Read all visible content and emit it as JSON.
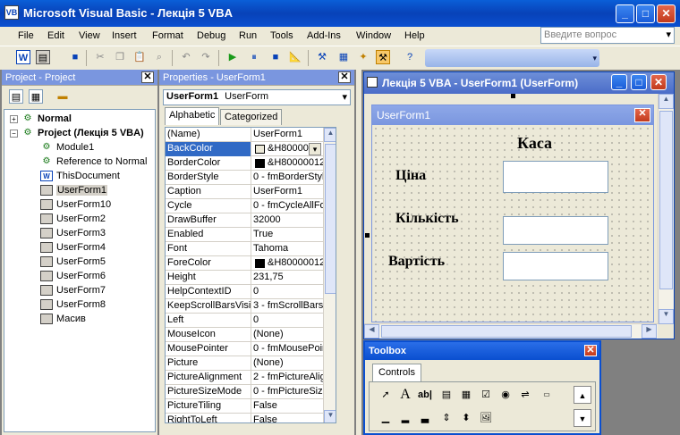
{
  "app": {
    "title": "Microsoft Visual Basic - Лекція 5 VBA"
  },
  "menu": {
    "items": [
      "File",
      "Edit",
      "View",
      "Insert",
      "Format",
      "Debug",
      "Run",
      "Tools",
      "Add-Ins",
      "Window",
      "Help"
    ],
    "ask_placeholder": "Введите вопрос"
  },
  "project_panel": {
    "title": "Project - Project",
    "nodes": [
      "Normal",
      "Project (Лекція 5 VBA)",
      "Module1",
      "Reference to Normal",
      "ThisDocument",
      "UserForm1",
      "UserForm10",
      "UserForm2",
      "UserForm3",
      "UserForm4",
      "UserForm5",
      "UserForm6",
      "UserForm7",
      "UserForm8",
      "Масив"
    ]
  },
  "properties_panel": {
    "title": "Properties - UserForm1",
    "object_name": "UserForm1",
    "object_type": "UserForm",
    "tab_alphabetic": "Alphabetic",
    "tab_categorized": "Categorized",
    "rows": [
      {
        "name": "(Name)",
        "value": "UserForm1"
      },
      {
        "name": "BackColor",
        "value": "&H8000000"
      },
      {
        "name": "BorderColor",
        "value": "&H80000012&"
      },
      {
        "name": "BorderStyle",
        "value": "0 - fmBorderStyleN"
      },
      {
        "name": "Caption",
        "value": "UserForm1"
      },
      {
        "name": "Cycle",
        "value": "0 - fmCycleAllForm"
      },
      {
        "name": "DrawBuffer",
        "value": "32000"
      },
      {
        "name": "Enabled",
        "value": "True"
      },
      {
        "name": "Font",
        "value": "Tahoma"
      },
      {
        "name": "ForeColor",
        "value": "&H80000012&"
      },
      {
        "name": "Height",
        "value": "231,75"
      },
      {
        "name": "HelpContextID",
        "value": "0"
      },
      {
        "name": "KeepScrollBarsVisible",
        "value": "3 - fmScrollBarsBo"
      },
      {
        "name": "Left",
        "value": "0"
      },
      {
        "name": "MouseIcon",
        "value": "(None)"
      },
      {
        "name": "MousePointer",
        "value": "0 - fmMousePointe"
      },
      {
        "name": "Picture",
        "value": "(None)"
      },
      {
        "name": "PictureAlignment",
        "value": "2 - fmPictureAlignm"
      },
      {
        "name": "PictureSizeMode",
        "value": "0 - fmPictureSizeM"
      },
      {
        "name": "PictureTiling",
        "value": "False"
      },
      {
        "name": "RightToLeft",
        "value": "False"
      }
    ]
  },
  "design_window": {
    "title": "Лекція 5 VBA - UserForm1 (UserForm)",
    "form_caption": "UserForm1",
    "labels": {
      "heading": "Каса",
      "price": "Ціна",
      "quantity": "Кількість",
      "total": "Вартість"
    }
  },
  "toolbox": {
    "title": "Toolbox",
    "tab": "Controls"
  },
  "colors": {
    "titlebar": "#0842b8",
    "selected_row": "#316ac5",
    "panel_bg": "#ece9d8"
  }
}
